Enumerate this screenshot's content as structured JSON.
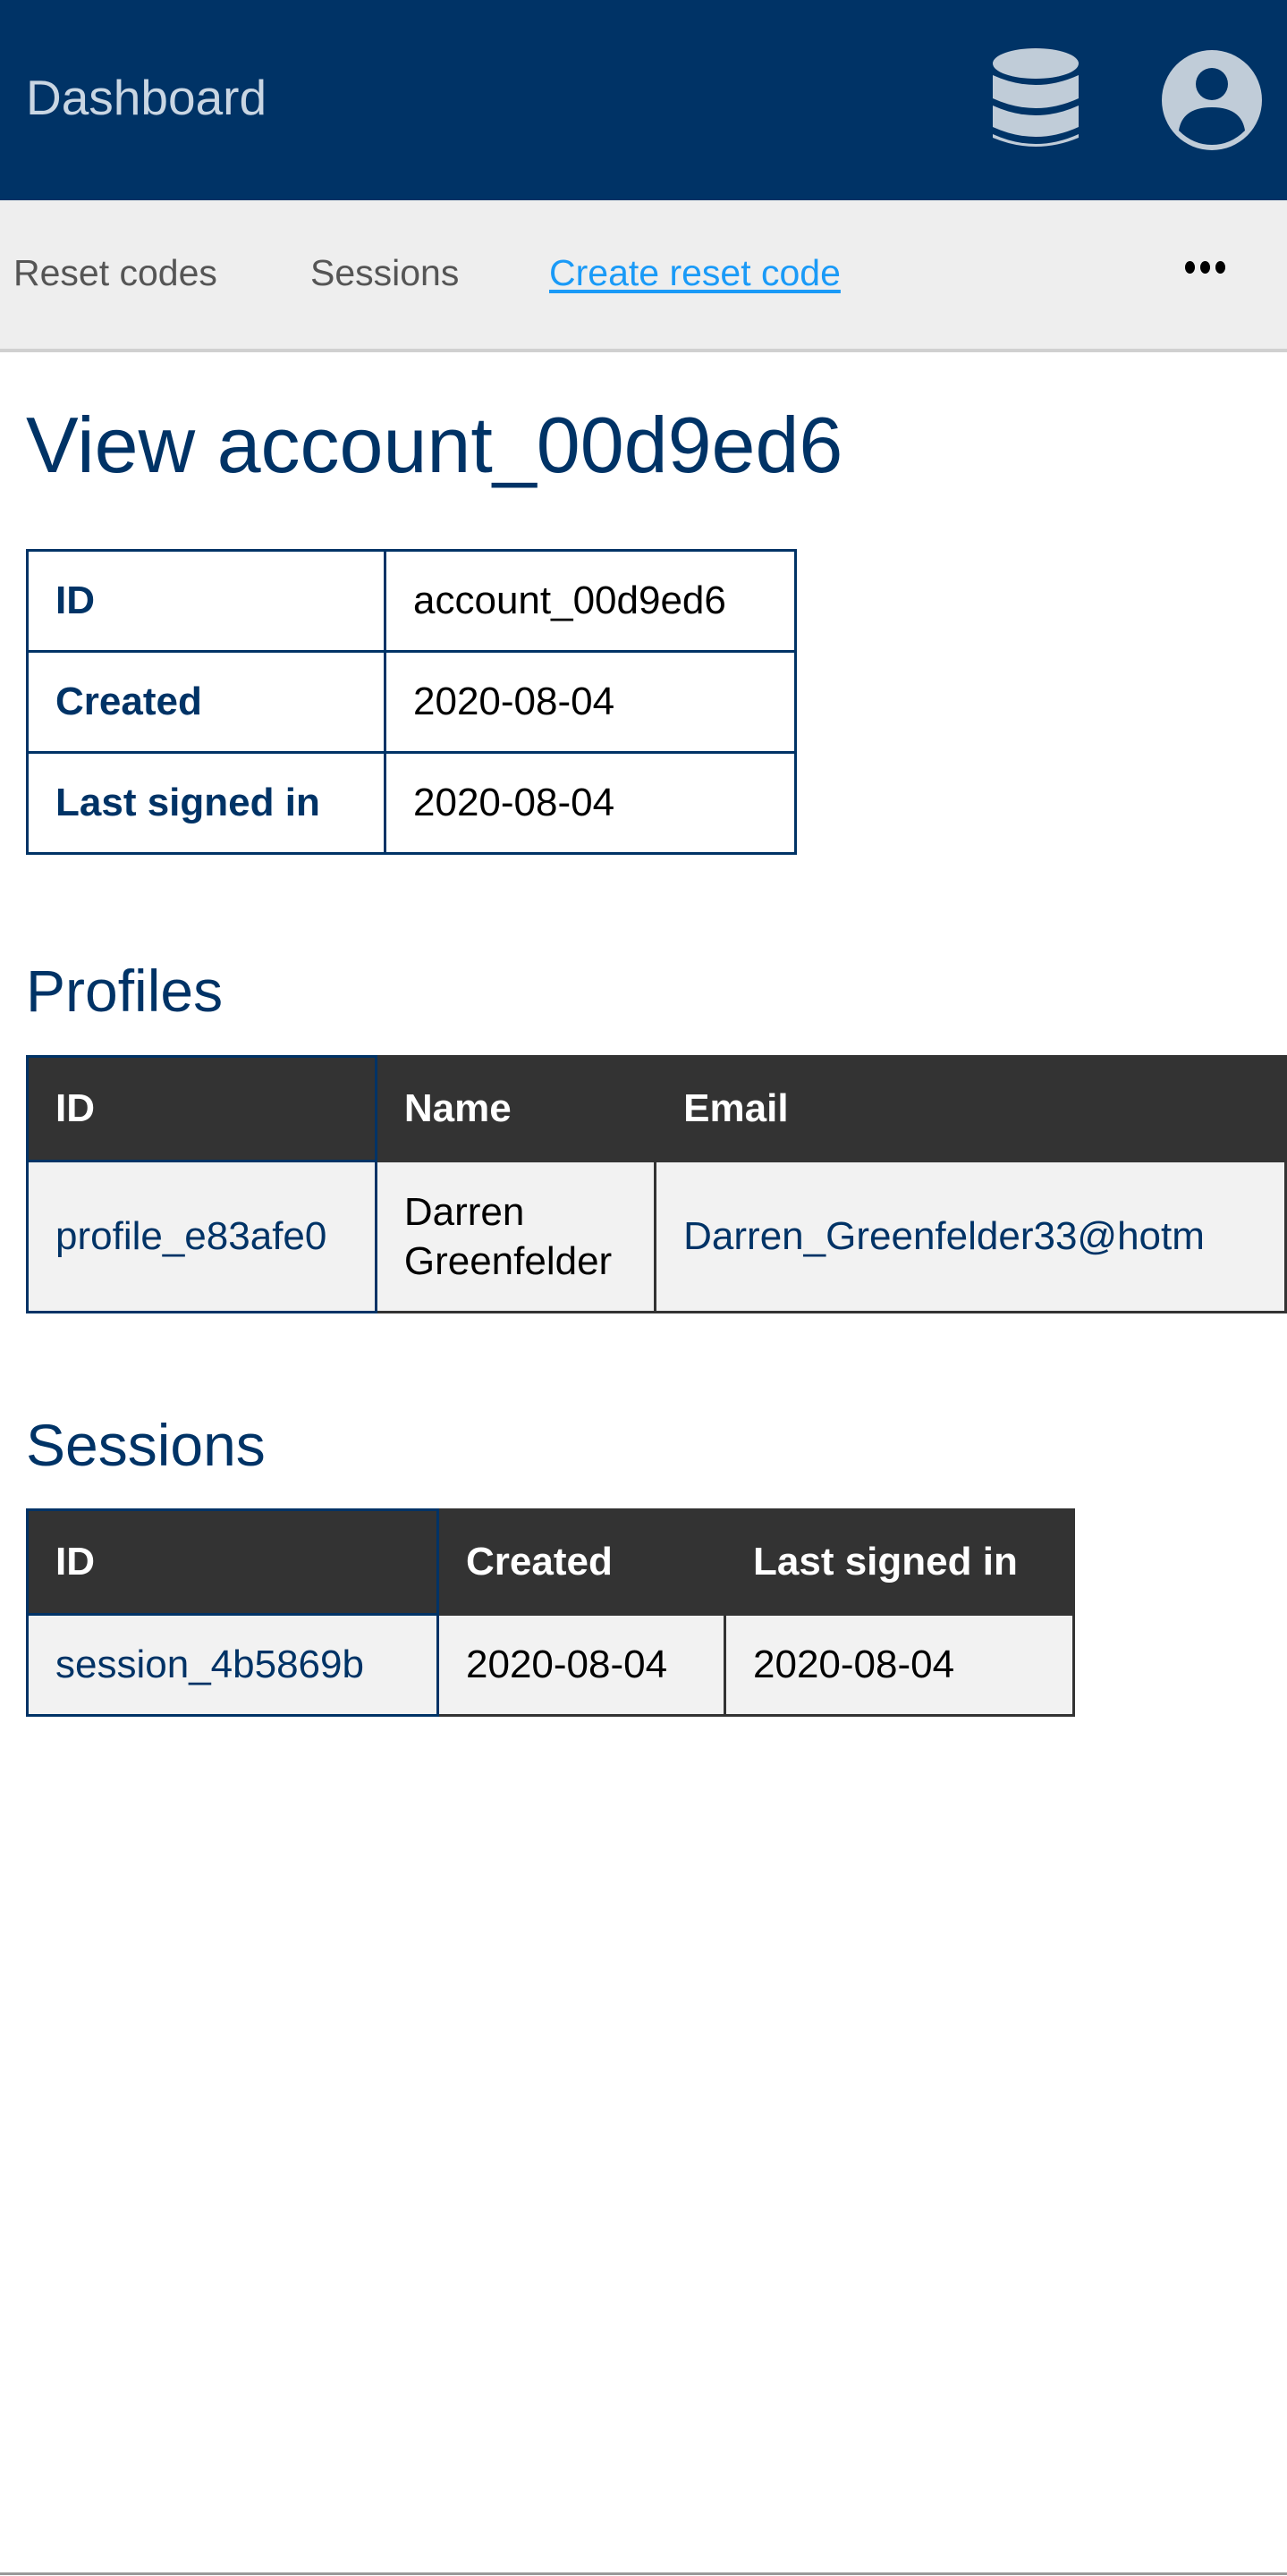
{
  "header": {
    "brand": "Dashboard",
    "icons": [
      "database-icon",
      "user-circle-icon"
    ],
    "colors": {
      "background": "#003366",
      "icon": "#c0ccd8"
    }
  },
  "nav": {
    "items": [
      {
        "label": "Reset codes"
      },
      {
        "label": "Sessions"
      },
      {
        "label": "Create reset code"
      }
    ],
    "more_icon": "ellipsis-icon"
  },
  "page": {
    "title": "View account_00d9ed6"
  },
  "account": {
    "rows": [
      {
        "label": "ID",
        "value": "account_00d9ed6"
      },
      {
        "label": "Created",
        "value": "2020-08-04"
      },
      {
        "label": "Last signed in",
        "value": "2020-08-04"
      }
    ]
  },
  "profiles": {
    "heading": "Profiles",
    "columns": [
      "ID",
      "Name",
      "Email"
    ],
    "rows": [
      {
        "id": "profile_e83afe0",
        "name_first": "Darren",
        "name_last": "Greenfelder",
        "email": "Darren_Greenfelder33@hotm"
      }
    ]
  },
  "sessions": {
    "heading": "Sessions",
    "columns": [
      "ID",
      "Created",
      "Last signed in"
    ],
    "rows": [
      {
        "id": "session_4b5869b",
        "created": "2020-08-04",
        "last_signed_in": "2020-08-04"
      }
    ]
  }
}
